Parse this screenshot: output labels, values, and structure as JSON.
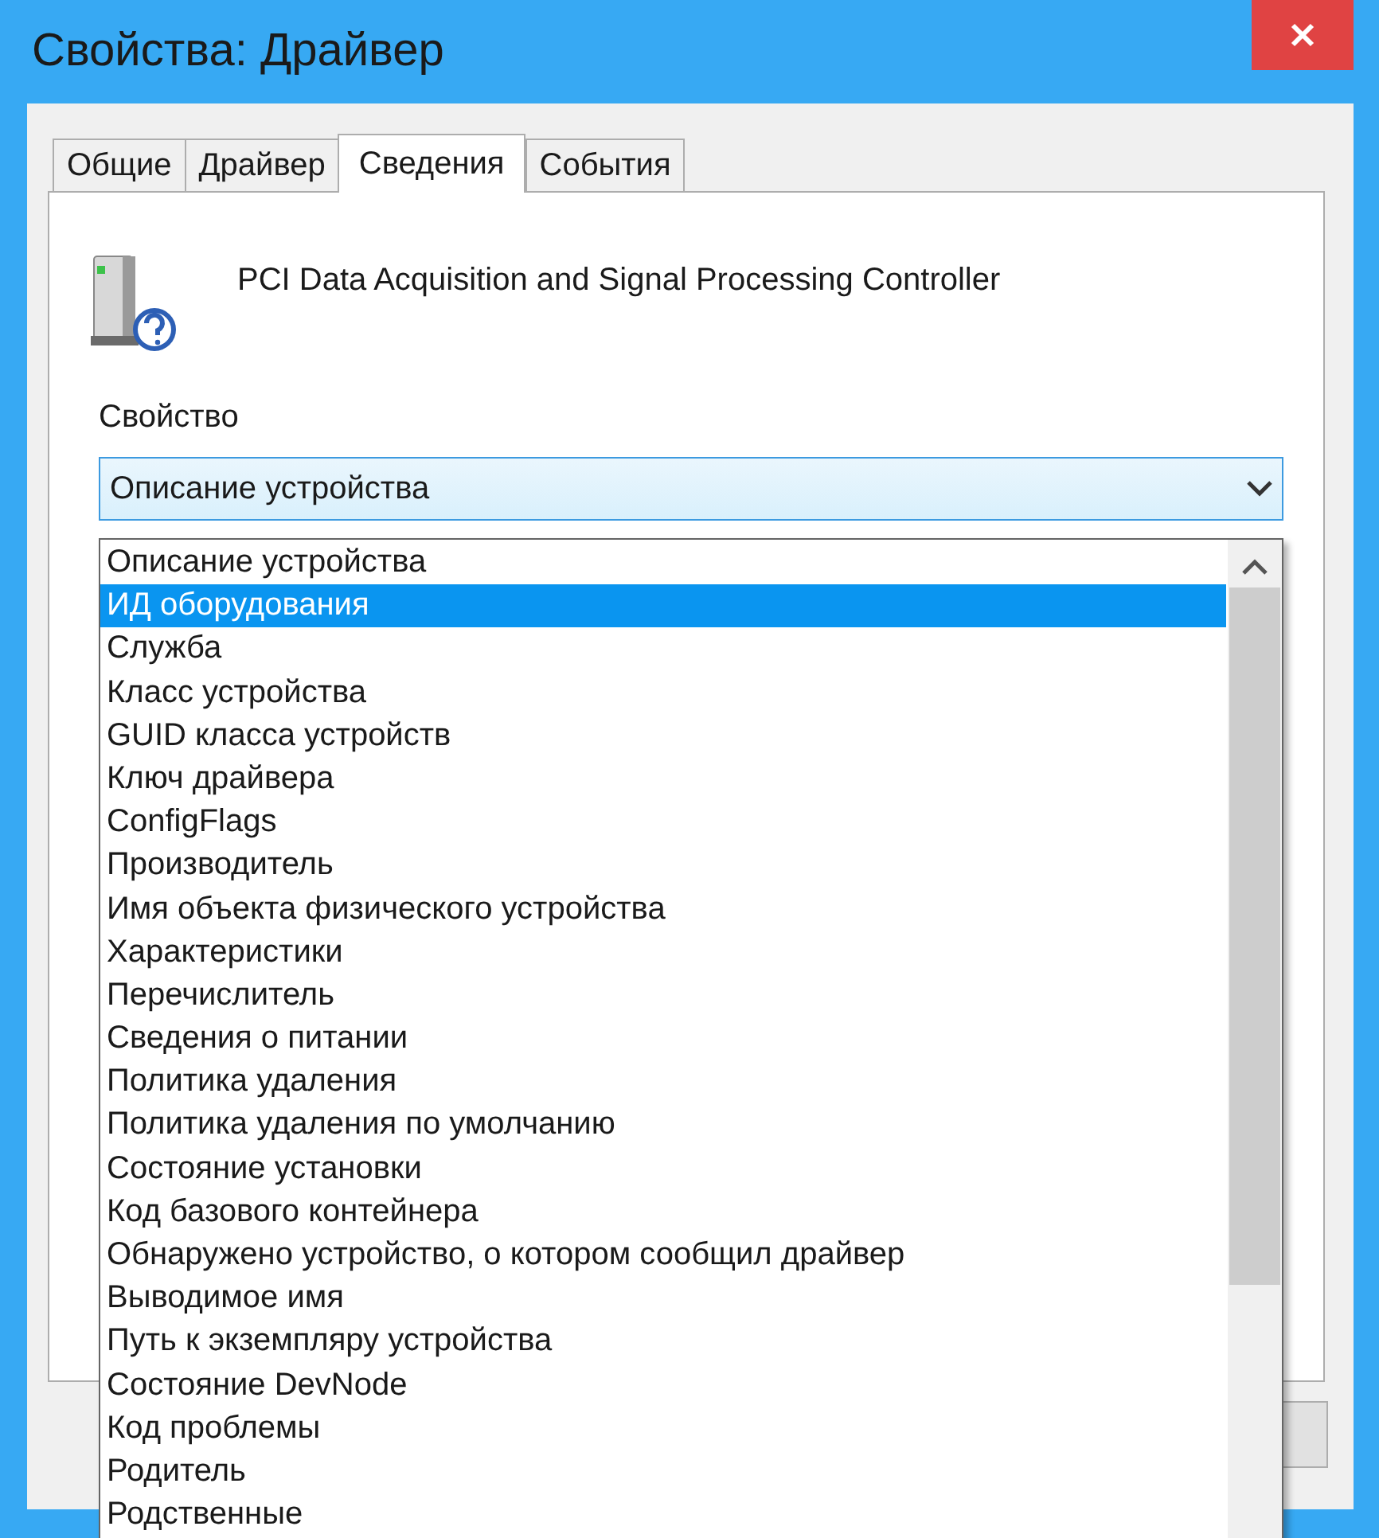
{
  "window": {
    "title": "Свойства: Драйвер"
  },
  "tabs": [
    {
      "label": "Общие",
      "selected": false
    },
    {
      "label": "Драйвер",
      "selected": false
    },
    {
      "label": "Сведения",
      "selected": true
    },
    {
      "label": "События",
      "selected": false
    }
  ],
  "device": {
    "name": "PCI Data Acquisition and Signal Processing Controller"
  },
  "property": {
    "label": "Свойство",
    "value": "Описание устройства",
    "expanded": true
  },
  "options": [
    {
      "label": "Описание устройства",
      "selected": false
    },
    {
      "label": "ИД оборудования",
      "selected": true
    },
    {
      "label": "Служба",
      "selected": false
    },
    {
      "label": "Класс устройства",
      "selected": false
    },
    {
      "label": "GUID класса устройств",
      "selected": false
    },
    {
      "label": "Ключ драйвера",
      "selected": false
    },
    {
      "label": "ConfigFlags",
      "selected": false
    },
    {
      "label": "Производитель",
      "selected": false
    },
    {
      "label": "Имя объекта физического устройства",
      "selected": false
    },
    {
      "label": "Характеристики",
      "selected": false
    },
    {
      "label": "Перечислитель",
      "selected": false
    },
    {
      "label": "Сведения о питании",
      "selected": false
    },
    {
      "label": "Политика удаления",
      "selected": false
    },
    {
      "label": "Политика удаления по умолчанию",
      "selected": false
    },
    {
      "label": "Состояние установки",
      "selected": false
    },
    {
      "label": "Код базового контейнера",
      "selected": false
    },
    {
      "label": "Обнаружено устройство, о котором сообщил драйвер",
      "selected": false
    },
    {
      "label": "Выводимое имя",
      "selected": false
    },
    {
      "label": "Путь к экземпляру устройства",
      "selected": false
    },
    {
      "label": "Состояние DevNode",
      "selected": false
    },
    {
      "label": "Код проблемы",
      "selected": false
    },
    {
      "label": "Родитель",
      "selected": false
    },
    {
      "label": "Родственные",
      "selected": false
    }
  ]
}
